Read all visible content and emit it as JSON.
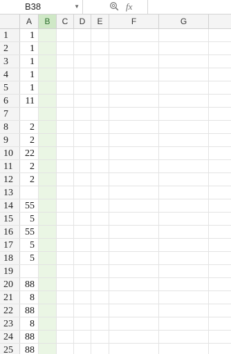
{
  "formula_bar": {
    "name_box": "B38",
    "name_dropdown_icon": "chevron-down-icon",
    "zoom_icon": "zoom-icon",
    "fx_label": "fx",
    "formula": ""
  },
  "columns": [
    "A",
    "B",
    "C",
    "D",
    "E",
    "F",
    "G"
  ],
  "selected_column": "B",
  "rows": [
    {
      "num": "1",
      "a": "1"
    },
    {
      "num": "2",
      "a": "1"
    },
    {
      "num": "3",
      "a": "1"
    },
    {
      "num": "4",
      "a": "1"
    },
    {
      "num": "5",
      "a": "1"
    },
    {
      "num": "6",
      "a": "11"
    },
    {
      "num": "7",
      "a": ""
    },
    {
      "num": "8",
      "a": "2"
    },
    {
      "num": "9",
      "a": "2"
    },
    {
      "num": "10",
      "a": "22"
    },
    {
      "num": "11",
      "a": "2"
    },
    {
      "num": "12",
      "a": "2"
    },
    {
      "num": "13",
      "a": ""
    },
    {
      "num": "14",
      "a": "55"
    },
    {
      "num": "15",
      "a": "5"
    },
    {
      "num": "16",
      "a": "55"
    },
    {
      "num": "17",
      "a": "5"
    },
    {
      "num": "18",
      "a": "5"
    },
    {
      "num": "19",
      "a": ""
    },
    {
      "num": "20",
      "a": "88"
    },
    {
      "num": "21",
      "a": "8"
    },
    {
      "num": "22",
      "a": "88"
    },
    {
      "num": "23",
      "a": "8"
    },
    {
      "num": "24",
      "a": "88"
    },
    {
      "num": "25",
      "a": "88"
    }
  ]
}
